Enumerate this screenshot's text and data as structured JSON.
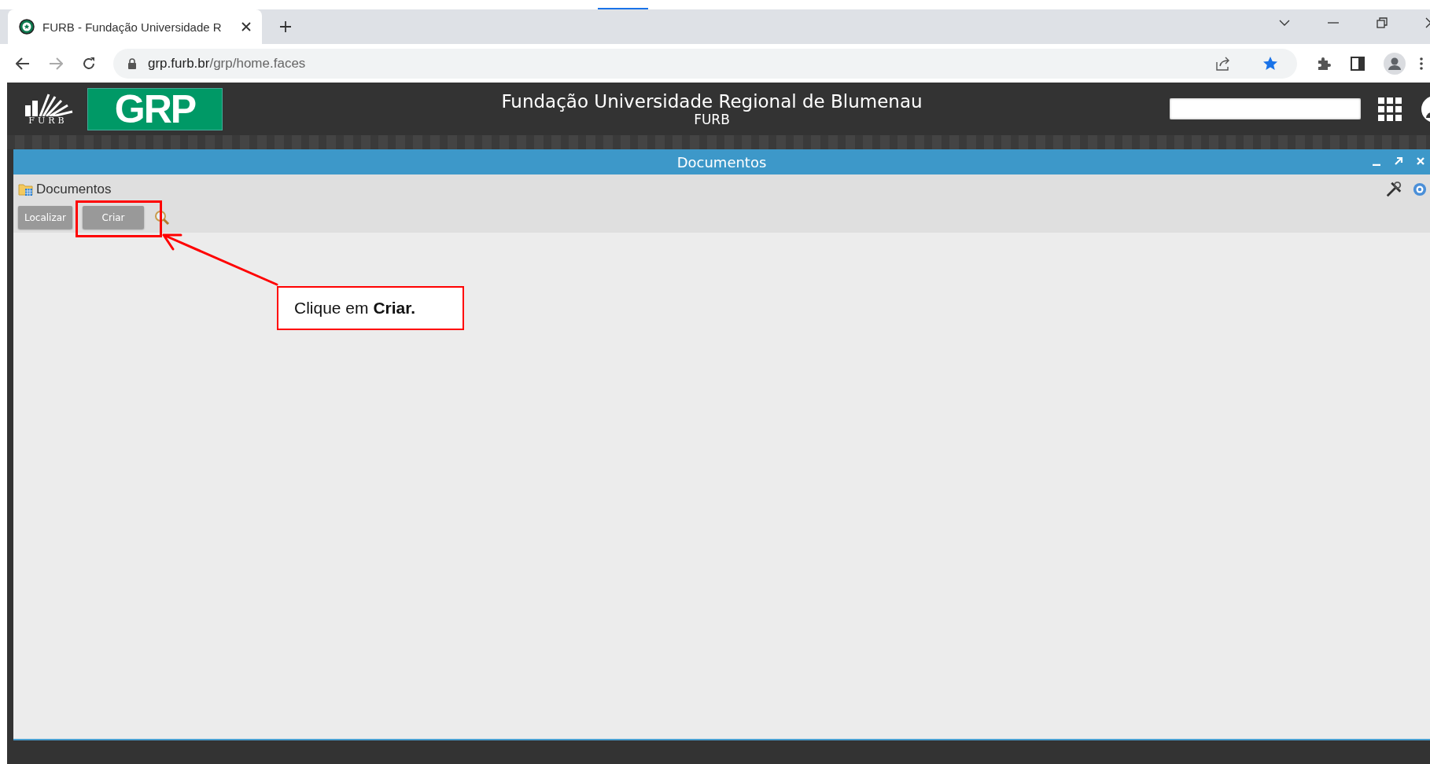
{
  "browser": {
    "tab_title": "FURB - Fundação Universidade R",
    "url_host": "grp.furb.br",
    "url_path": "/grp/home.faces"
  },
  "app_header": {
    "logo_text": "FURB",
    "brand": "GRP",
    "title": "Fundação Universidade Regional de Blumenau",
    "subtitle": "FURB"
  },
  "panel": {
    "title": "Documentos",
    "breadcrumb": "Documentos",
    "buttons": [
      "Localizar",
      "Criar"
    ]
  },
  "annotation": {
    "text": "Clique em **Criar.**"
  }
}
